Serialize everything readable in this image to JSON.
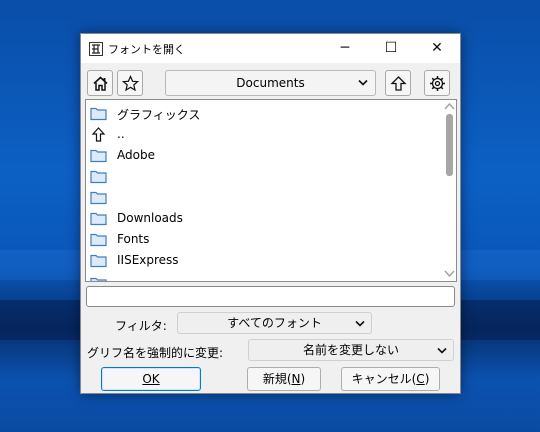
{
  "window": {
    "title": "フォントを開く",
    "minimize_glyph": "─",
    "maximize_glyph": "☐",
    "close_glyph": "✕"
  },
  "toolbar": {
    "path": "Documents",
    "icons": [
      "home-icon",
      "star-icon",
      "up-arrow-icon",
      "gear-icon"
    ]
  },
  "file_list": {
    "items": [
      {
        "label": "グラフィックス",
        "icon": "folder-icon"
      },
      {
        "label": "..",
        "icon": "up-arrow-icon"
      },
      {
        "label": "Adobe",
        "icon": "folder-icon"
      },
      {
        "label": "",
        "icon": "folder-icon"
      },
      {
        "label": "",
        "icon": "folder-icon"
      },
      {
        "label": "Downloads",
        "icon": "folder-icon"
      },
      {
        "label": "Fonts",
        "icon": "folder-icon"
      },
      {
        "label": "IISExpress",
        "icon": "folder-icon"
      }
    ]
  },
  "filename_input": {
    "value": ""
  },
  "filter": {
    "label": "フィルタ:",
    "selected": "すべてのフォント"
  },
  "rename": {
    "label": "グリフ名を強制的に変更:",
    "selected": "名前を変更しない"
  },
  "buttons": {
    "ok": {
      "text": "",
      "mnemonic": "OK"
    },
    "new": {
      "text": "新規(",
      "mnemonic": "N",
      "suffix": ")"
    },
    "cancel": {
      "text": "キャンセル(",
      "mnemonic": "C",
      "suffix": ")"
    }
  },
  "colors": {
    "accent": "#0078d7",
    "folder_fill": "#dceaf9",
    "folder_stroke": "#3f7fc0",
    "desktop": "#0a56b8"
  }
}
